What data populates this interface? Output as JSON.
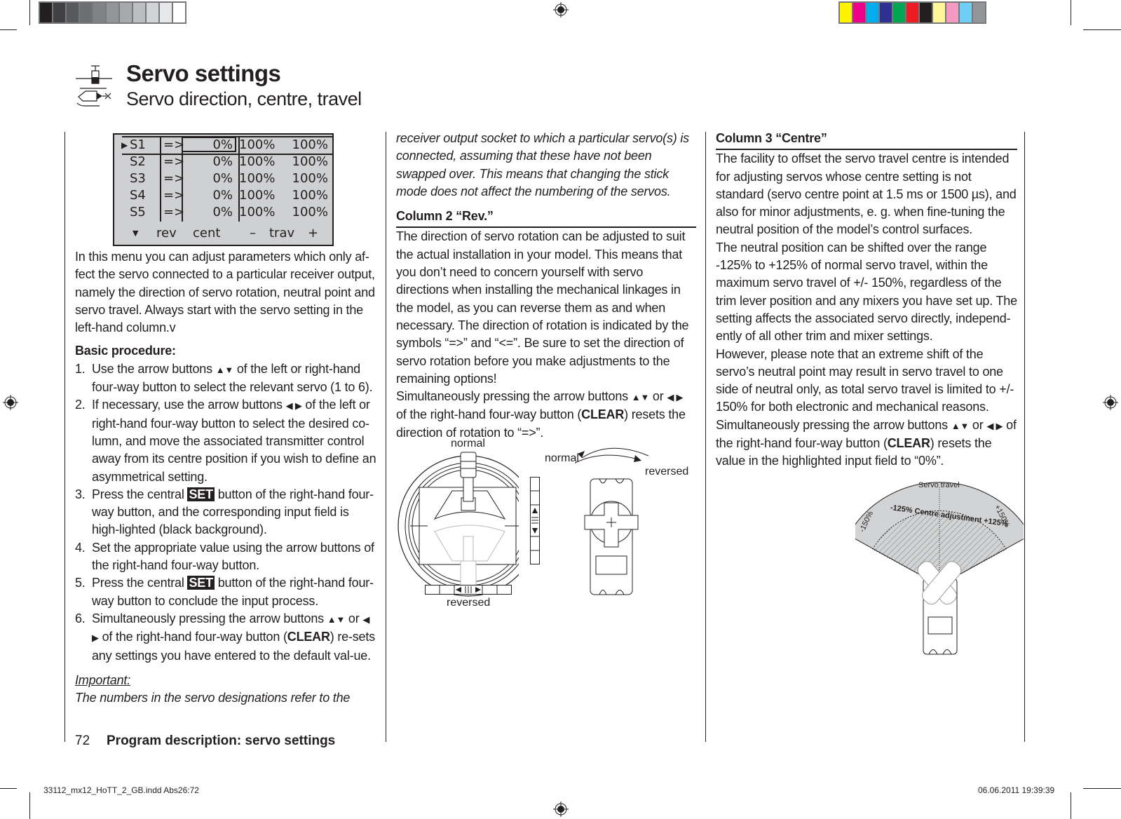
{
  "print_marks": {
    "gray_swatches": [
      "#231f20",
      "#414042",
      "#58595b",
      "#6d6e71",
      "#808285",
      "#939598",
      "#a7a9ac",
      "#bcbec0",
      "#d1d3d4",
      "#e6e7e8",
      "#ffffff"
    ],
    "color_swatches": [
      "#fff200",
      "#ec008c",
      "#00aeef",
      "#2e3192",
      "#00a651",
      "#ed1c24",
      "#231f20",
      "#fff799",
      "#f49ac1",
      "#6dcff6",
      "#939598"
    ],
    "slug_left": "33112_mx12_HoTT_2_GB.indd   Abs26:72",
    "slug_right": "06.06.2011   19:39:39"
  },
  "header": {
    "title": "Servo settings",
    "subtitle": "Servo direction, centre, travel",
    "icons": [
      "airplane-icon",
      "helicopter-icon"
    ]
  },
  "lcd": {
    "rows": [
      {
        "servo": "S1",
        "rev": "=>",
        "cent": "0%",
        "trav_minus": "100%",
        "trav_plus": "100%",
        "selected": true
      },
      {
        "servo": "S2",
        "rev": "=>",
        "cent": "0%",
        "trav_minus": "100%",
        "trav_plus": "100%",
        "selected": false
      },
      {
        "servo": "S3",
        "rev": "=>",
        "cent": "0%",
        "trav_minus": "100%",
        "trav_plus": "100%",
        "selected": false
      },
      {
        "servo": "S4",
        "rev": "=>",
        "cent": "0%",
        "trav_minus": "100%",
        "trav_plus": "100%",
        "selected": false
      },
      {
        "servo": "S5",
        "rev": "=>",
        "cent": "0%",
        "trav_minus": "100%",
        "trav_plus": "100%",
        "selected": false
      }
    ],
    "footer": {
      "down": "▼",
      "rev": "rev",
      "cent": "cent",
      "minus": "–",
      "trav": "trav",
      "plus": "+"
    }
  },
  "col1": {
    "intro": "In this menu you can adjust parameters which only af-fect the servo connected to a particular receiver output, namely the direction of servo rotation, neutral point and servo travel. Always start with the servo setting in the left-hand column.v",
    "basic_heading": "Basic procedure:",
    "steps": [
      {
        "num": "1.",
        "a": "Use the arrow buttons ",
        "sym": "▲▼",
        "b": " of the left or right-hand four-way button to select the relevant servo (1 to 6)."
      },
      {
        "num": "2.",
        "a": "If necessary, use the arrow buttons ",
        "sym": "◀ ▶",
        "b": " of the left or right-hand four-way button to select the desired co-lumn, and move the associated transmitter control away from its centre position if you wish to define an asymmetrical setting."
      },
      {
        "num": "3.",
        "a": "Press the central ",
        "set": "SET",
        "b": " button of the right-hand four-way button, and the corresponding input field is high-lighted (black background)."
      },
      {
        "num": "4.",
        "a": "Set the appropriate value using the arrow buttons of the right-hand four-way button."
      },
      {
        "num": "5.",
        "a": "Press the central ",
        "set": "SET",
        "b": " button of the right-hand four-way button to conclude the input process."
      },
      {
        "num": "6.",
        "a": "Simultaneously pressing the arrow buttons ",
        "sym": "▲▼",
        "c": " or ",
        "sym2": "◀ ▶",
        "d": " of the right-hand four-way button (",
        "bold": "CLEAR",
        "b": ") re-sets any settings you have entered to the default val-ue."
      }
    ],
    "important_label": "Important:",
    "important_text": "The numbers in the servo designations refer to the"
  },
  "col2": {
    "italic_cont": "receiver output socket to which a particular servo(s) is connected, assuming that these have not been swapped over. This means that changing the stick mode does not affect the numbering of the servos.",
    "heading": "Column 2 “Rev.”",
    "para1": "The direction of servo rotation can be adjusted to suit the actual installation in your model. This means that you don’t need to concern yourself with servo directions when installing the mechanical linkages in the model, as you can reverse them as and when necessary. The direction of rotation is indicated by the symbols “=>” and “<=”. Be sure to set the direction of servo rotation before you make adjustments to the remaining options!",
    "para2_a": "Simultaneously pressing the arrow buttons ",
    "para2_sym": "▲▼",
    "para2_or": " or ",
    "para2_sym2": "◀ ▶",
    "para2_b": " of the right-hand four-way button (",
    "para2_bold": "CLEAR",
    "para2_c": ") resets the direction of rotation to “=>”.",
    "figure": {
      "stick_top_label": "normal",
      "stick_bottom_label": "reversed",
      "servo_normal_label": "normal",
      "servo_reversed_label": "reversed"
    }
  },
  "col3": {
    "heading": "Column 3 “Centre”",
    "para1": "The facility to offset the servo travel centre is intended for adjusting servos whose centre setting is not standard (servo centre point at 1.5 ms or 1500 µs), and also for minor adjustments, e. g. when fine-tuning the neutral position of the model’s control surfaces.",
    "para2": "The neutral position can be shifted over the range -125% to +125% of normal servo travel, within the maximum servo travel of +/- 150%, regardless of the trim lever position and any mixers you have set up. The setting affects the associated servo directly, independ-ently of all other trim and mixer settings.",
    "para3": "However, please note that an extreme shift of the servo’s neutral point may result in servo travel to one side of neutral only, as total servo travel is limited to +/- 150% for both electronic and mechanical reasons.",
    "para4_a": "Simultaneously pressing the arrow buttons ",
    "para4_sym": "▲▼",
    "para4_or": " or ",
    "para4_sym2": "◀ ▶",
    "para4_b": " of the right-hand four-way button (",
    "para4_bold": "CLEAR",
    "para4_c": ") resets the value in the highlighted input field to “0%”.",
    "figure": {
      "title": "Servo travel",
      "inner_label": "-125% Centre adjustment +125%",
      "left_limit": "-150%",
      "right_limit": "+150%"
    }
  },
  "footer": {
    "page_number": "72",
    "section": "Program description: servo settings"
  }
}
